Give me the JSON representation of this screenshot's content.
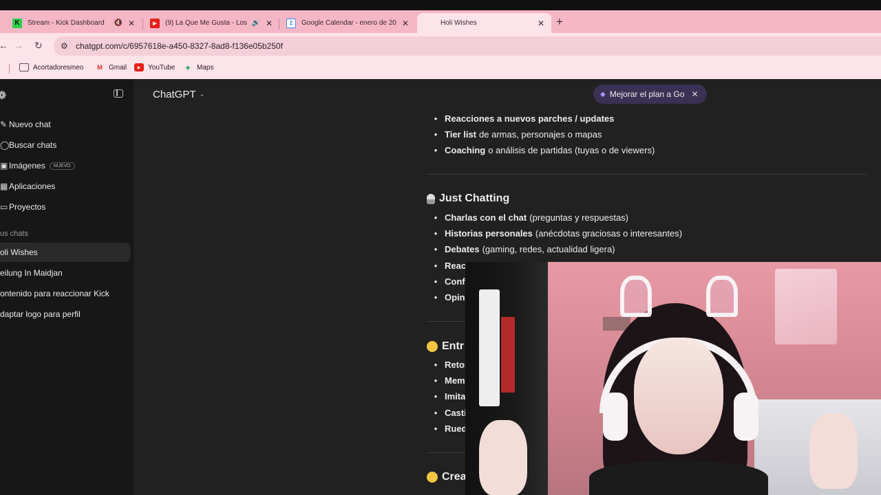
{
  "browser": {
    "tabs": [
      {
        "title": "Stream - Kick Dashboard",
        "favicon": "kick-icon",
        "muted": true,
        "active": false
      },
      {
        "title": "(9) La Que Me Gusta - Los A",
        "favicon": "youtube-icon",
        "audio": true,
        "active": false
      },
      {
        "title": "Google Calendar - enero de 20",
        "favicon": "calendar-icon",
        "active": false
      },
      {
        "title": "Holi Wishes",
        "favicon": "chatgpt-icon",
        "active": true
      }
    ],
    "url": "chatgpt.com/c/6957618e-a450-8327-8ad8-f136e05b250f",
    "bookmarks": [
      {
        "label": "Acortadoresmeo",
        "icon": "folder-icon"
      },
      {
        "label": "Gmail",
        "icon": "gmail-icon"
      },
      {
        "label": "YouTube",
        "icon": "youtube-icon"
      },
      {
        "label": "Maps",
        "icon": "maps-icon"
      }
    ]
  },
  "sidebar": {
    "items": [
      {
        "label": "Nuevo chat",
        "icon": "edit-icon"
      },
      {
        "label": "Buscar chats",
        "icon": "search-icon"
      },
      {
        "label": "Imágenes",
        "icon": "image-icon",
        "badge": "NUEVO"
      },
      {
        "label": "Aplicaciones",
        "icon": "apps-icon"
      },
      {
        "label": "Proyectos",
        "icon": "folder-icon"
      }
    ],
    "section_label": "us chats",
    "chats": [
      {
        "label": "oli Wishes",
        "active": true
      },
      {
        "label": "eilung In Maidjan",
        "active": false
      },
      {
        "label": "ontenido para reaccionar Kick",
        "active": false
      },
      {
        "label": "daptar logo para perfil",
        "active": false
      }
    ]
  },
  "header": {
    "model": "ChatGPT",
    "upgrade": "Mejorar el plan a Go"
  },
  "content": {
    "list1": [
      {
        "bold": "Reacciones a nuevos parches / updates",
        "rest": ""
      },
      {
        "bold": "Tier list",
        "rest": "de armas, personajes o mapas"
      },
      {
        "bold": "Coaching",
        "rest": "o análisis de partidas (tuyas o de viewers)"
      }
    ],
    "section2": {
      "title": "Just Chatting",
      "emoji": "microphone"
    },
    "list2": [
      {
        "bold": "Charlas con el chat",
        "rest": "(preguntas y respuestas)"
      },
      {
        "bold": "Historias personales",
        "rest": "(anécdotas graciosas o interesantes)"
      },
      {
        "bold": "Debates",
        "rest": "(gaming, redes, actualidad ligera)"
      },
      {
        "bold": "Reac",
        "rest": ""
      },
      {
        "bold": "Conf",
        "rest": ""
      },
      {
        "bold": "Opin",
        "rest": ""
      }
    ],
    "section3": {
      "title": "Entr",
      "emoji": "laughing-face"
    },
    "list3": [
      {
        "bold": "Retos",
        "rest": ""
      },
      {
        "bold": "Mem",
        "rest": ""
      },
      {
        "bold": "Imita",
        "rest": ""
      },
      {
        "bold": "Casti",
        "rest": ""
      },
      {
        "bold": "Rued",
        "rest": ""
      }
    ],
    "section4": {
      "title": "Crea",
      "emoji": "smirk-face"
    }
  },
  "colors": {
    "tabbar": "#f5b6c6",
    "sidebar": "#171717",
    "main": "#212121",
    "upgrade_bg": "#3a3154"
  }
}
